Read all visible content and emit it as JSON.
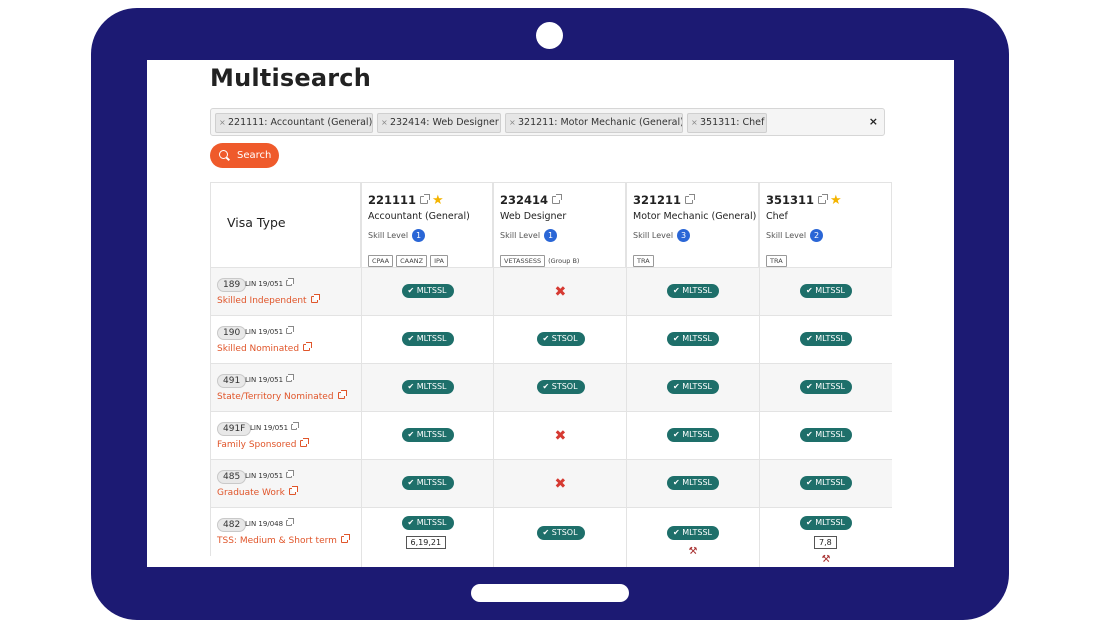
{
  "page": {
    "title": "Multisearch"
  },
  "search": {
    "chips": [
      {
        "label": "221111: Accountant (General)"
      },
      {
        "label": "232414: Web Designer"
      },
      {
        "label": "321211: Motor Mechanic (General)"
      },
      {
        "label": "351311: Chef"
      }
    ],
    "clear_label": "×",
    "button_label": "Search"
  },
  "table": {
    "visa_type_header": "Visa Type",
    "occupations": [
      {
        "code": "221111",
        "name": "Accountant (General)",
        "skill_label": "Skill Level",
        "skill_level": "1",
        "starred": true,
        "tags": [
          "CPAA",
          "CAANZ",
          "IPA"
        ],
        "tag_note": ""
      },
      {
        "code": "232414",
        "name": "Web Designer",
        "skill_label": "Skill Level",
        "skill_level": "1",
        "starred": false,
        "tags": [
          "VETASSESS"
        ],
        "tag_note": "(Group B)"
      },
      {
        "code": "321211",
        "name": "Motor Mechanic (General)",
        "skill_label": "Skill Level",
        "skill_level": "3",
        "starred": false,
        "tags": [
          "TRA"
        ],
        "tag_note": ""
      },
      {
        "code": "351311",
        "name": "Chef",
        "skill_label": "Skill Level",
        "skill_level": "2",
        "starred": true,
        "tags": [
          "TRA"
        ],
        "tag_note": ""
      }
    ],
    "rows": [
      {
        "subclass": "189",
        "lin": "LIN 19/051",
        "name": "Skilled Independent",
        "cells": [
          {
            "type": "badge",
            "label": "✔ MLTSSL"
          },
          {
            "type": "cross",
            "label": "✖"
          },
          {
            "type": "badge",
            "label": "✔ MLTSSL"
          },
          {
            "type": "badge",
            "label": "✔ MLTSSL"
          }
        ]
      },
      {
        "subclass": "190",
        "lin": "LIN 19/051",
        "name": "Skilled Nominated",
        "cells": [
          {
            "type": "badge",
            "label": "✔ MLTSSL"
          },
          {
            "type": "badge",
            "label": "✔ STSOL"
          },
          {
            "type": "badge",
            "label": "✔ MLTSSL"
          },
          {
            "type": "badge",
            "label": "✔ MLTSSL"
          }
        ]
      },
      {
        "subclass": "491",
        "lin": "LIN 19/051",
        "name": "State/Territory Nominated",
        "cells": [
          {
            "type": "badge",
            "label": "✔ MLTSSL"
          },
          {
            "type": "badge",
            "label": "✔ STSOL"
          },
          {
            "type": "badge",
            "label": "✔ MLTSSL"
          },
          {
            "type": "badge",
            "label": "✔ MLTSSL"
          }
        ]
      },
      {
        "subclass": "491F",
        "lin": "LIN 19/051",
        "name": "Family Sponsored",
        "cells": [
          {
            "type": "badge",
            "label": "✔ MLTSSL"
          },
          {
            "type": "cross",
            "label": "✖"
          },
          {
            "type": "badge",
            "label": "✔ MLTSSL"
          },
          {
            "type": "badge",
            "label": "✔ MLTSSL"
          }
        ]
      },
      {
        "subclass": "485",
        "lin": "LIN 19/051",
        "name": "Graduate Work",
        "cells": [
          {
            "type": "badge",
            "label": "✔ MLTSSL"
          },
          {
            "type": "cross",
            "label": "✖"
          },
          {
            "type": "badge",
            "label": "✔ MLTSSL"
          },
          {
            "type": "badge",
            "label": "✔ MLTSSL"
          }
        ]
      },
      {
        "subclass": "482",
        "lin": "LIN 19/048",
        "name": "TSS: Medium & Short term",
        "cells": [
          {
            "type": "badge",
            "label": "✔ MLTSSL",
            "extra": "6,19,21"
          },
          {
            "type": "badge",
            "label": "✔ STSOL"
          },
          {
            "type": "badge",
            "label": "✔ MLTSSL",
            "gavel": true
          },
          {
            "type": "badge",
            "label": "✔ MLTSSL",
            "extra": "7,8",
            "gavel": true
          }
        ]
      }
    ]
  },
  "colors": {
    "device": "#1c1a73",
    "accent": "#ef5a2b",
    "badge": "#1e6f6a",
    "cross": "#d63a32",
    "skill": "#2a66d6",
    "star": "#f4b400"
  }
}
